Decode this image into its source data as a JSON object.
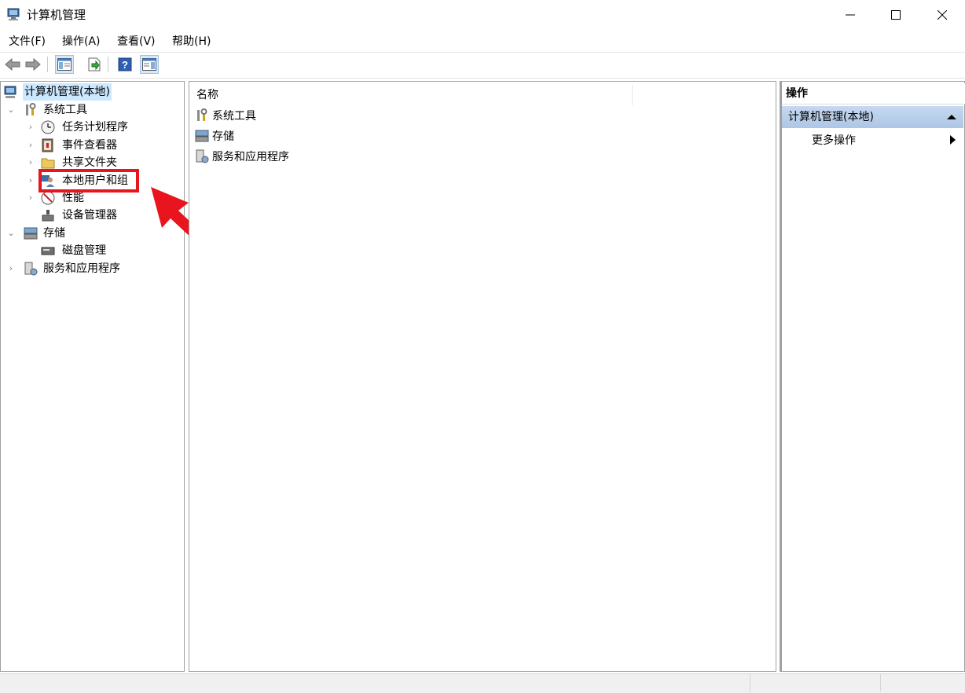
{
  "window": {
    "title": "计算机管理"
  },
  "menu": [
    "文件(F)",
    "操作(A)",
    "查看(V)",
    "帮助(H)"
  ],
  "tree": {
    "root": "计算机管理(本地)",
    "system_tools": "系统工具",
    "task_scheduler": "任务计划程序",
    "event_viewer": "事件查看器",
    "shared_folders": "共享文件夹",
    "local_users": "本地用户和组",
    "performance": "性能",
    "device_manager": "设备管理器",
    "storage": "存储",
    "disk_management": "磁盘管理",
    "services_apps": "服务和应用程序"
  },
  "center": {
    "column_name": "名称",
    "items": [
      "系统工具",
      "存储",
      "服务和应用程序"
    ]
  },
  "actions": {
    "header": "操作",
    "group": "计算机管理(本地)",
    "more": "更多操作"
  },
  "colors": {
    "selection": "#cce8ff",
    "highlight": "#e8141e",
    "group": "#b8cfea"
  }
}
